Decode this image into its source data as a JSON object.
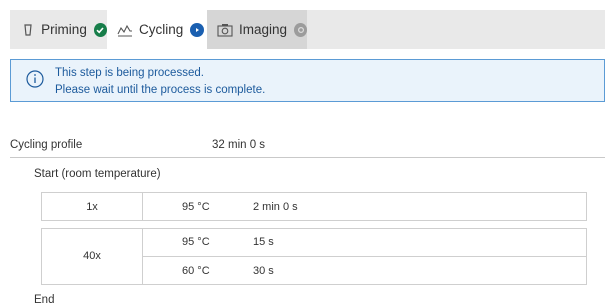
{
  "tabs": [
    {
      "label": "Priming",
      "status": "done",
      "status_color": "#177e4a"
    },
    {
      "label": "Cycling",
      "status": "active",
      "status_color": "#1a5fb0"
    },
    {
      "label": "Imaging",
      "status": "pending",
      "status_color": "#9c9c9c"
    }
  ],
  "notice": {
    "line1": "This step is being processed.",
    "line2": "Please wait until the process is complete.",
    "icon": "info-icon"
  },
  "profile": {
    "label": "Cycling profile",
    "duration": "32 min 0 s"
  },
  "start_label": "Start (room temperature)",
  "end_label": "End",
  "stages": [
    {
      "repeat": "1x",
      "steps": [
        {
          "temp": "95 °C",
          "time": "2 min 0 s"
        }
      ]
    },
    {
      "repeat": "40x",
      "steps": [
        {
          "temp": "95 °C",
          "time": "15 s"
        },
        {
          "temp": "60 °C",
          "time": "30 s"
        }
      ]
    }
  ]
}
